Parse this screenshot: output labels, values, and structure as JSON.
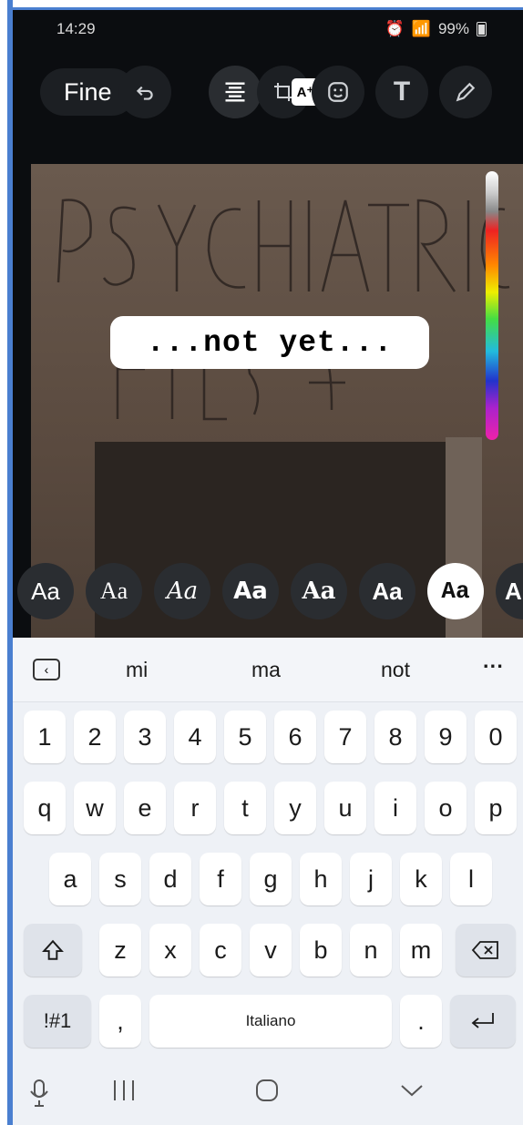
{
  "status": {
    "time": "14:29",
    "battery": "99%"
  },
  "toolbar": {
    "done_label": "Fine",
    "text_tool_label": "T"
  },
  "caption": {
    "text": "...not yet..."
  },
  "fonts": [
    "Aa",
    "Aa",
    "Aa",
    "Aa",
    "Aa",
    "Aa",
    "Aa",
    "A"
  ],
  "keyboard": {
    "suggestions": [
      "mi",
      "ma",
      "not"
    ],
    "numbers": [
      "1",
      "2",
      "3",
      "4",
      "5",
      "6",
      "7",
      "8",
      "9",
      "0"
    ],
    "row1": [
      "q",
      "w",
      "e",
      "r",
      "t",
      "y",
      "u",
      "i",
      "o",
      "p"
    ],
    "row2": [
      "a",
      "s",
      "d",
      "f",
      "g",
      "h",
      "j",
      "k",
      "l"
    ],
    "row3": [
      "z",
      "x",
      "c",
      "v",
      "b",
      "n",
      "m"
    ],
    "symbols_label": "!#1",
    "comma": ",",
    "space_label": "Italiano",
    "period": "."
  }
}
